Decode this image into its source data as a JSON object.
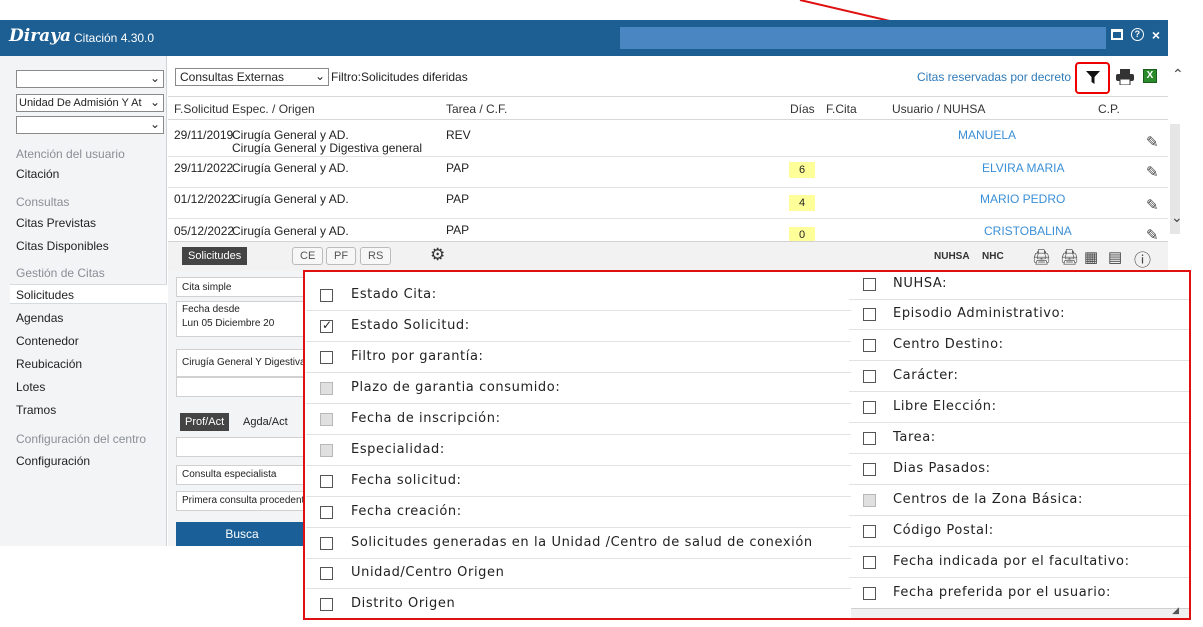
{
  "app": {
    "logo": "Diraya",
    "title": "Citación 4.30.0",
    "help_glyph": "?",
    "close_glyph": "×"
  },
  "sidebar": {
    "select1": "",
    "select2": "Unidad De Admisión Y At",
    "select3": "",
    "groups": {
      "atencion": "Atención del usuario",
      "consultas": "Consultas",
      "gestion": "Gestión de Citas",
      "config": "Configuración del centro"
    },
    "items": {
      "citacion": "Citación",
      "citas_previstas": "Citas Previstas",
      "citas_disponibles": "Citas Disponibles",
      "solicitudes": "Solicitudes",
      "agendas": "Agendas",
      "contenedor": "Contenedor",
      "reubicacion": "Reubicación",
      "lotes": "Lotes",
      "tramos": "Tramos",
      "configuracion": "Configuración"
    }
  },
  "main": {
    "consulta_select": "Consultas Externas",
    "filter_label": "Filtro:Solicitudes diferidas",
    "decreto_link": "Citas reservadas por decreto",
    "columns": {
      "fsolicitud": "F.Solicitud",
      "espec": "Espec. / Origen",
      "tarea": "Tarea / C.F.",
      "dias": "Días",
      "fcita": "F.Cita",
      "usuario": "Usuario / NUHSA",
      "cp": "C.P."
    },
    "rows": [
      {
        "fecha": "29/11/2019",
        "espec": "Cirugía General y AD.",
        "origen": "Cirugía General y Digestiva general",
        "tarea": "REV",
        "dias": "",
        "usuario": "MANUELA"
      },
      {
        "fecha": "29/11/2022",
        "espec": "Cirugía General y AD.",
        "origen": "",
        "tarea": "PAP",
        "dias": "6",
        "usuario": "ELVIRA MARIA"
      },
      {
        "fecha": "01/12/2022",
        "espec": "Cirugía General y AD.",
        "origen": "",
        "tarea": "PAP",
        "dias": "4",
        "usuario": "MARIO PEDRO"
      },
      {
        "fecha": "05/12/2022",
        "espec": "Cirugía General y AD.",
        "origen": "",
        "tarea": "PAP",
        "dias": "0",
        "usuario": "CRISTOBALINA"
      }
    ]
  },
  "toolbar": {
    "solicitudes_tab": "Solicitudes",
    "ce": "CE",
    "pf": "PF",
    "rs": "RS",
    "nuhsa": "NUHSA",
    "nhc": "NHC"
  },
  "form": {
    "tipo_cita": "Cita simple",
    "fecha_desde_label": "Fecha desde",
    "fecha_desde_value": "Lun  05 Diciembre 20",
    "especialidad": "Cirugía General Y Digestiva",
    "tab_prof": "Prof/Act",
    "tab_agda": "Agda/Act",
    "consulta": "Consulta especialista",
    "primera": "Primera consulta procedente",
    "buscar": "Busca"
  },
  "popup": {
    "left": [
      {
        "label": "Estado Cita:",
        "state": "unchecked"
      },
      {
        "label": "Estado Solicitud:",
        "state": "checked"
      },
      {
        "label": "Filtro por garantía:",
        "state": "unchecked"
      },
      {
        "label": "Plazo de garantia consumido:",
        "state": "disabled"
      },
      {
        "label": "Fecha de inscripción:",
        "state": "disabled"
      },
      {
        "label": "Especialidad:",
        "state": "disabled"
      },
      {
        "label": "Fecha solicitud:",
        "state": "unchecked"
      },
      {
        "label": "Fecha creación:",
        "state": "unchecked"
      },
      {
        "label": "Solicitudes generadas en la Unidad /Centro de salud de conexión",
        "state": "unchecked"
      },
      {
        "label": "Unidad/Centro Origen",
        "state": "unchecked"
      },
      {
        "label": "Distrito Origen",
        "state": "unchecked"
      }
    ],
    "right": [
      {
        "label": "NUHSA:",
        "state": "unchecked"
      },
      {
        "label": "Episodio Administrativo:",
        "state": "unchecked"
      },
      {
        "label": "Centro Destino:",
        "state": "unchecked"
      },
      {
        "label": "Carácter:",
        "state": "unchecked"
      },
      {
        "label": "Libre Elección:",
        "state": "unchecked"
      },
      {
        "label": "Tarea:",
        "state": "unchecked"
      },
      {
        "label": "Dias Pasados:",
        "state": "unchecked"
      },
      {
        "label": "Centros de la Zona Básica:",
        "state": "disabled"
      },
      {
        "label": "Código Postal:",
        "state": "unchecked"
      },
      {
        "label": "Fecha indicada por el facultativo:",
        "state": "unchecked"
      },
      {
        "label": "Fecha preferida por el usuario:",
        "state": "unchecked"
      }
    ]
  },
  "colors": {
    "titlebar": "#1d5f93",
    "annotation": "#e01010",
    "link": "#3b8fd6",
    "highlight": "#ffff99"
  }
}
